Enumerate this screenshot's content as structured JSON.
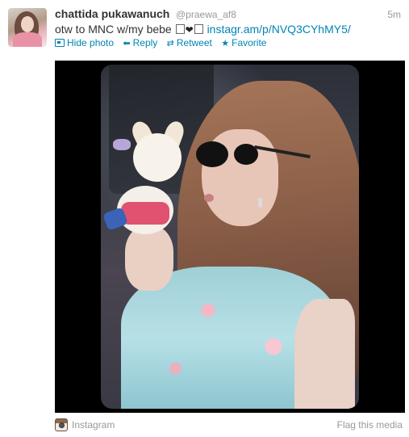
{
  "tweet": {
    "name": "chattida pukawanuch",
    "handle": "@praewa_af8",
    "time": "5m",
    "text_prefix": "otw to MNC w/my bebe",
    "link": "instagr.am/p/NVQ3CYhMY5/"
  },
  "actions": {
    "hide_photo": "Hide photo",
    "reply": "Reply",
    "retweet": "Retweet",
    "favorite": "Favorite"
  },
  "icons": {
    "photo": "photo-icon",
    "reply": "reply-arrow-icon",
    "retweet": "retweet-icon",
    "favorite": "star-icon",
    "instagram": "instagram-icon"
  },
  "footer": {
    "source": "Instagram",
    "flag": "Flag this media"
  },
  "colors": {
    "link": "#0084b4",
    "name": "#333333",
    "muted": "#999999",
    "media_bg": "#000000"
  }
}
